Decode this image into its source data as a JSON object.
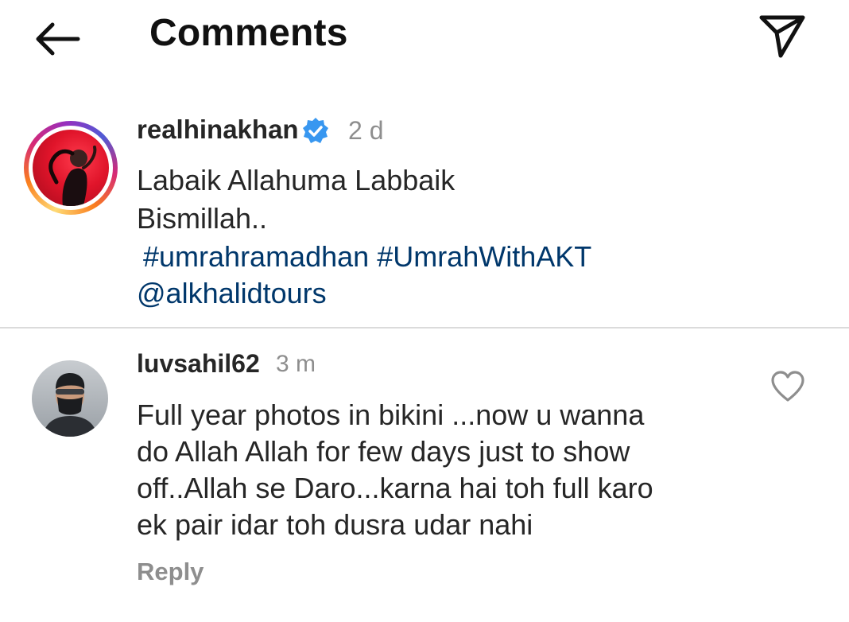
{
  "header": {
    "title": "Comments",
    "back_icon": "arrow-left-icon",
    "send_icon": "paper-plane-icon"
  },
  "caption": {
    "username": "realhinakhan",
    "verified": true,
    "verified_color": "#3897f0",
    "time": "2 d",
    "lines": [
      "Labaik Allahuma Labbaik",
      "Bismillah.."
    ],
    "hashtags": [
      "#umrahramadhan",
      "#UmrahWithAKT"
    ],
    "mention": "@alkhalidtours",
    "link_color": "#00376b"
  },
  "comment": {
    "username": "luvsahil62",
    "time": "3 m",
    "lines": [
      "Full year photos in bikini ...now u wanna",
      "do Allah Allah for few days just to show",
      "off..Allah se Daro...karna hai toh full karo",
      "ek pair idar toh dusra udar nahi"
    ],
    "reply_label": "Reply",
    "like_icon": "heart-outline-icon"
  }
}
